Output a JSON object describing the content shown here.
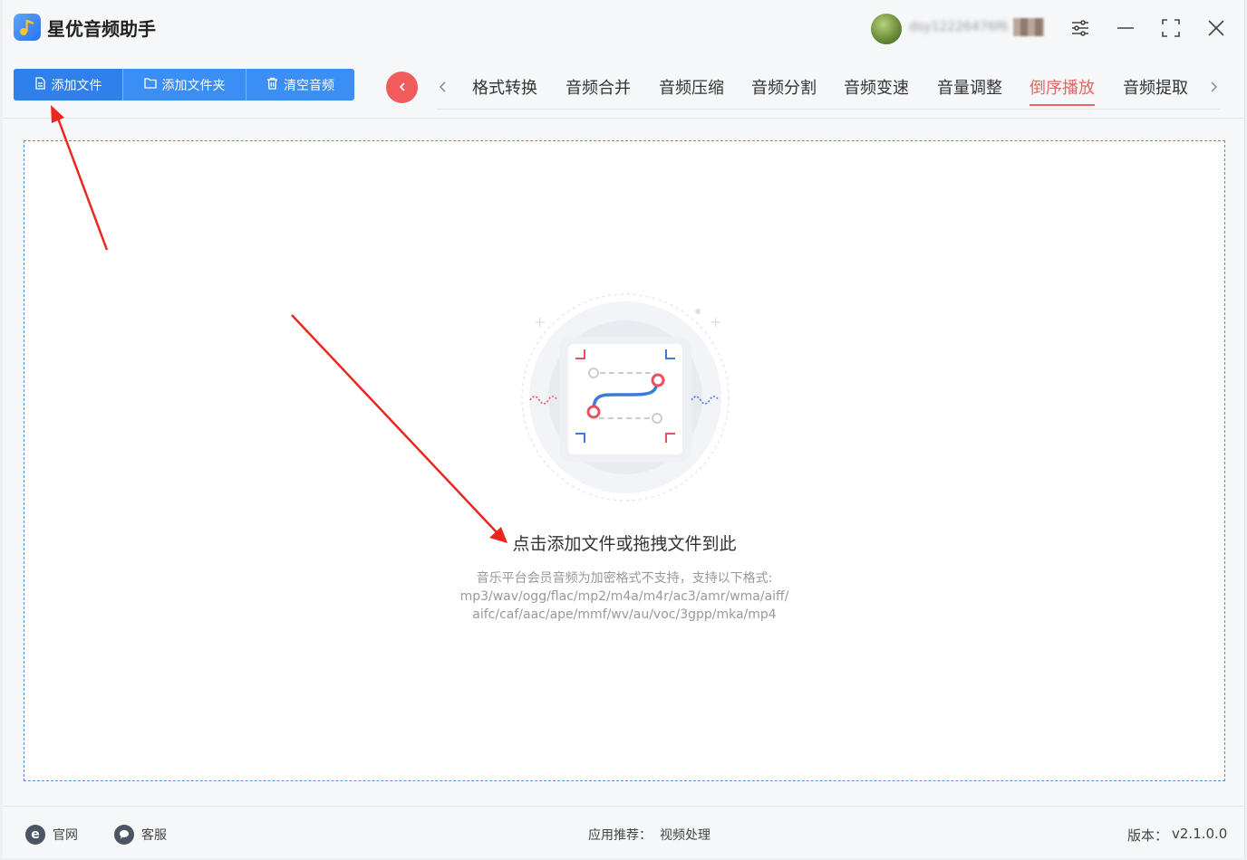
{
  "app": {
    "title": "星优音频助手",
    "username": "dsy12226476f6",
    "version_label": "版本：",
    "version": "v2.1.0.0"
  },
  "toolbar": {
    "add_file": "添加文件",
    "add_folder": "添加文件夹",
    "clear_audio": "清空音频"
  },
  "tabs": [
    {
      "label": "格式转换",
      "active": false
    },
    {
      "label": "音频合并",
      "active": false
    },
    {
      "label": "音频压缩",
      "active": false
    },
    {
      "label": "音频分割",
      "active": false
    },
    {
      "label": "音频变速",
      "active": false
    },
    {
      "label": "音量调整",
      "active": false
    },
    {
      "label": "倒序播放",
      "active": true
    },
    {
      "label": "音频提取",
      "active": false
    }
  ],
  "dropzone": {
    "main": "点击添加文件或拖拽文件到此",
    "sub_line1": "音乐平台会员音频为加密格式不支持，支持以下格式:",
    "sub_line2": "mp3/wav/ogg/flac/mp2/m4a/m4r/ac3/amr/wma/aiff/",
    "sub_line3": "aifc/caf/aac/ape/mmf/wv/au/voc/3gpp/mka/mp4"
  },
  "footer": {
    "website": "官网",
    "support": "客服",
    "recommend_label": "应用推荐：",
    "recommend_value": "视频处理"
  },
  "colors": {
    "accent_blue": "#3b8ef3",
    "active_tab": "#e96363",
    "back_button": "#f15b5b",
    "annotation_arrow": "#e8271e"
  },
  "icons": [
    "app-logo-icon",
    "settings-sliders-icon",
    "minimize-icon",
    "maximize-icon",
    "close-icon",
    "file-icon",
    "folder-icon",
    "trash-icon",
    "back-arrow-icon",
    "chevron-left-icon",
    "chevron-right-icon",
    "ie-browser-icon",
    "chat-bubble-icon"
  ]
}
